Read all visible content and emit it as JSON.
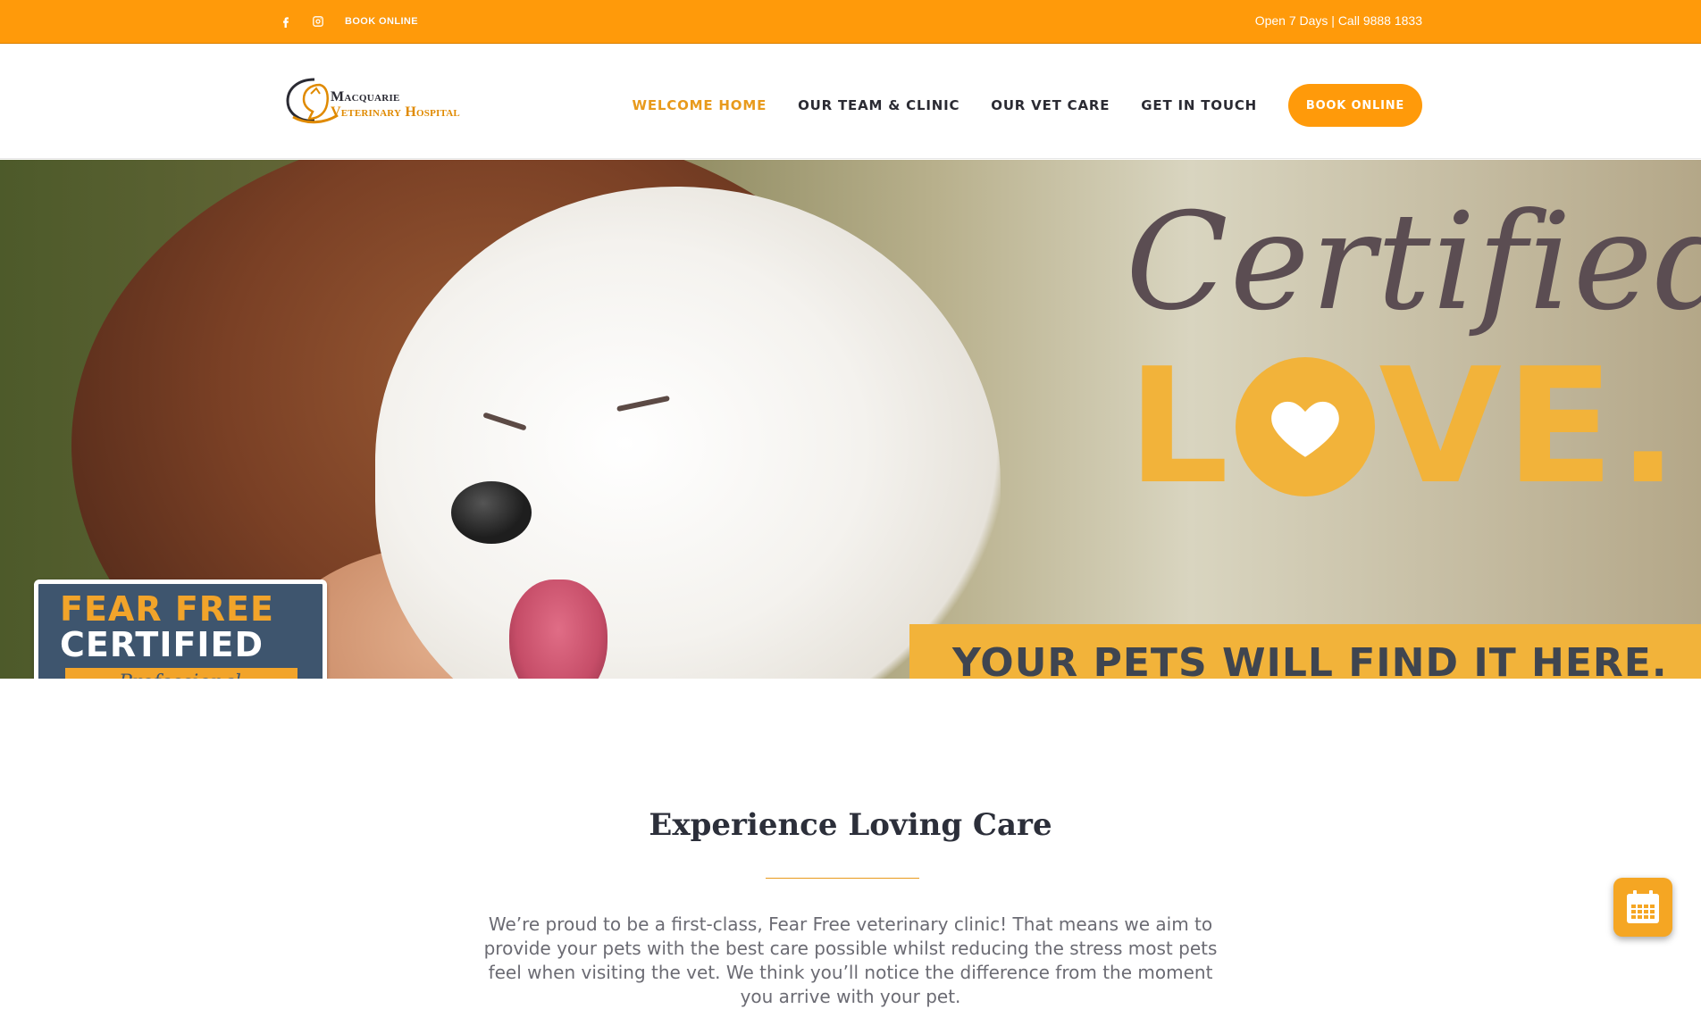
{
  "topbar": {
    "social": [
      {
        "icon": "facebook-icon"
      },
      {
        "icon": "instagram-icon"
      }
    ],
    "book_label": "BOOK ONLINE",
    "info_text": "Open 7 Days | Call 9888 1833",
    "background_color": "#ff9a0a"
  },
  "header": {
    "logo": {
      "line1": "Macquarie",
      "line2": "Veterinary Hospital"
    },
    "nav": [
      {
        "label": "WELCOME HOME",
        "active": true
      },
      {
        "label": "OUR TEAM & CLINIC",
        "active": false
      },
      {
        "label": "OUR VET CARE",
        "active": false
      },
      {
        "label": "GET IN TOUCH",
        "active": false
      }
    ],
    "book_button": "BOOK ONLINE",
    "accent_color": "#e89a1c"
  },
  "hero": {
    "script_word": "Certified",
    "love_before": "L",
    "love_after": "VE.",
    "tagline": "YOUR PETS WILL FIND IT HERE.",
    "badge": {
      "line1": "FEAR FREE",
      "line2": "CERTIFIED",
      "line3": "Professional"
    }
  },
  "content": {
    "title": "Experience Loving Care",
    "paragraph": "We’re proud to be a first-class, Fear Free veterinary clinic! That means we aim to provide your pets with the best care possible whilst reducing the stress most pets feel when visiting the vet. We think you’ll notice the difference from the moment you arrive with your pet."
  },
  "floating": {
    "icon": "calendar-icon"
  }
}
